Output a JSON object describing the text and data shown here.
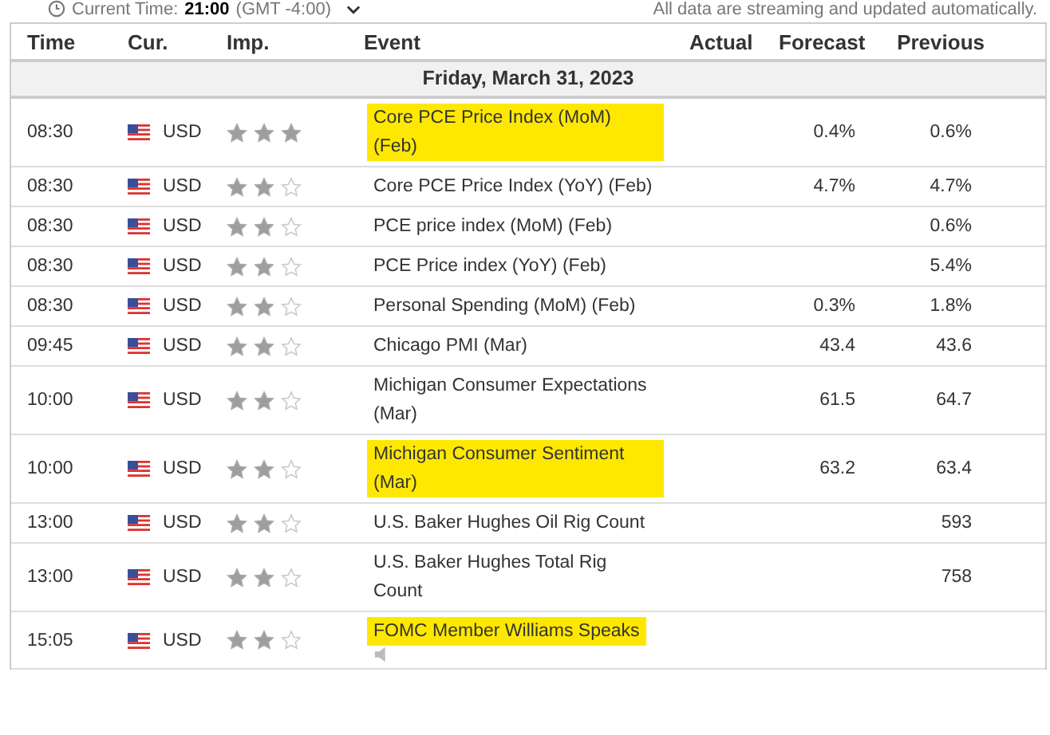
{
  "top_bar": {
    "time_label": "Current Time:",
    "time_value": "21:00",
    "timezone": "(GMT -4:00)",
    "notice": "All data are streaming and updated automatically."
  },
  "table": {
    "columns": [
      "Time",
      "Cur.",
      "Imp.",
      "Event",
      "Actual",
      "Forecast",
      "Previous"
    ],
    "date_header": "Friday, March 31, 2023",
    "rows": [
      {
        "time": "08:30",
        "currency": "USD",
        "stars": 3,
        "event": "Core PCE Price Index (MoM) (Feb)",
        "highlighted": true,
        "actual": "",
        "forecast": "0.4%",
        "previous": "0.6%"
      },
      {
        "time": "08:30",
        "currency": "USD",
        "stars": 2,
        "event": "Core PCE Price Index (YoY) (Feb)",
        "highlighted": false,
        "actual": "",
        "forecast": "4.7%",
        "previous": "4.7%"
      },
      {
        "time": "08:30",
        "currency": "USD",
        "stars": 2,
        "event": "PCE price index (MoM) (Feb)",
        "highlighted": false,
        "actual": "",
        "forecast": "",
        "previous": "0.6%"
      },
      {
        "time": "08:30",
        "currency": "USD",
        "stars": 2,
        "event": "PCE Price index (YoY) (Feb)",
        "highlighted": false,
        "actual": "",
        "forecast": "",
        "previous": "5.4%"
      },
      {
        "time": "08:30",
        "currency": "USD",
        "stars": 2,
        "event": "Personal Spending (MoM) (Feb)",
        "highlighted": false,
        "actual": "",
        "forecast": "0.3%",
        "previous": "1.8%"
      },
      {
        "time": "09:45",
        "currency": "USD",
        "stars": 2,
        "event": "Chicago PMI (Mar)",
        "highlighted": false,
        "actual": "",
        "forecast": "43.4",
        "previous": "43.6"
      },
      {
        "time": "10:00",
        "currency": "USD",
        "stars": 2,
        "event": "Michigan Consumer Expectations (Mar)",
        "highlighted": false,
        "actual": "",
        "forecast": "61.5",
        "previous": "64.7"
      },
      {
        "time": "10:00",
        "currency": "USD",
        "stars": 2,
        "event": "Michigan Consumer Sentiment (Mar)",
        "highlighted": true,
        "actual": "",
        "forecast": "63.2",
        "previous": "63.4"
      },
      {
        "time": "13:00",
        "currency": "USD",
        "stars": 2,
        "event": "U.S. Baker Hughes Oil Rig Count",
        "highlighted": false,
        "actual": "",
        "forecast": "",
        "previous": "593"
      },
      {
        "time": "13:00",
        "currency": "USD",
        "stars": 2,
        "event": "U.S. Baker Hughes Total Rig Count",
        "highlighted": false,
        "actual": "",
        "forecast": "",
        "previous": "758"
      },
      {
        "time": "15:05",
        "currency": "USD",
        "stars": 2,
        "event": "FOMC Member Williams Speaks",
        "highlighted": true,
        "audio": true,
        "actual": "",
        "forecast": "",
        "previous": ""
      }
    ]
  }
}
